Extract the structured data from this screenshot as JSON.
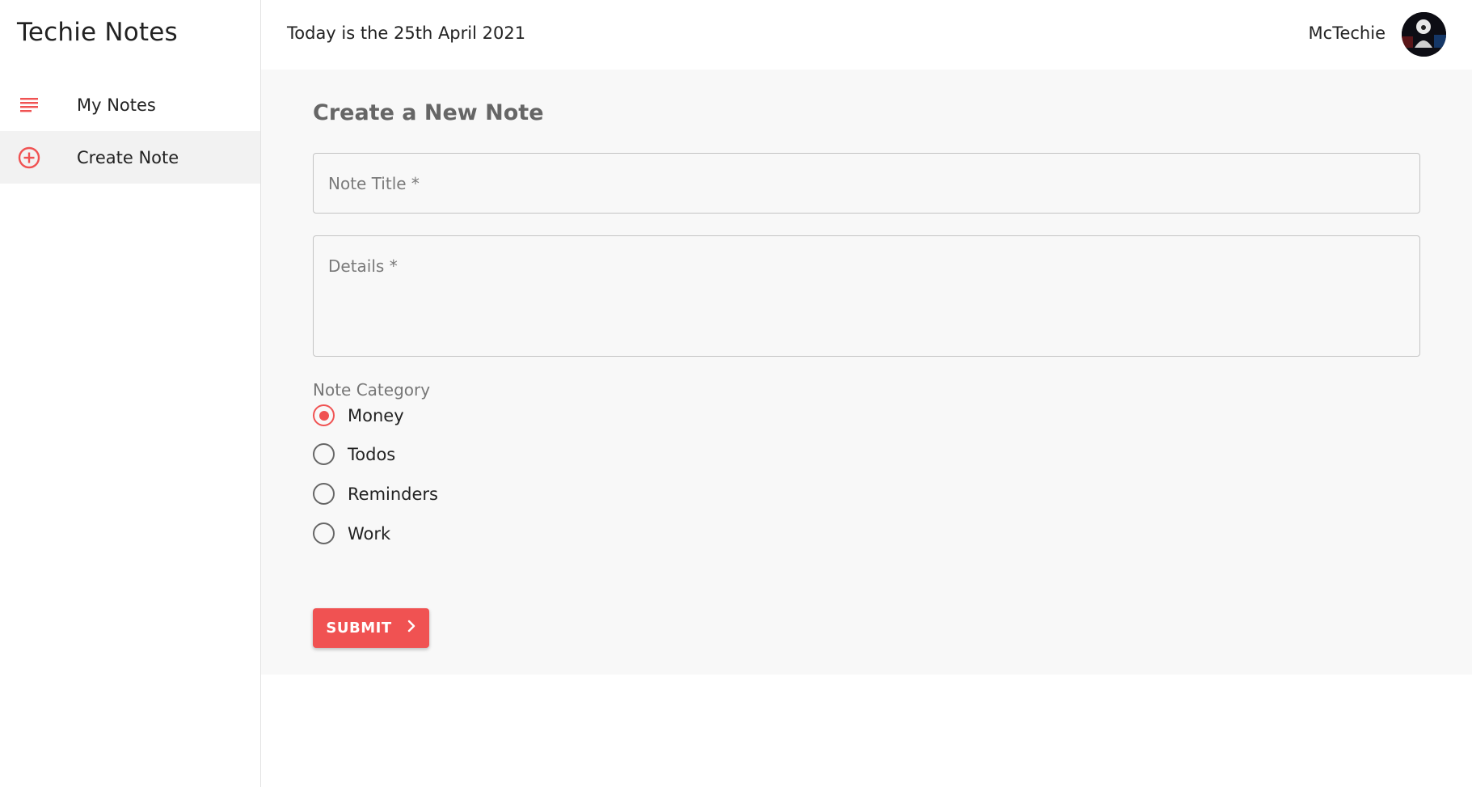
{
  "sidebar": {
    "brand": "Techie Notes",
    "items": [
      {
        "label": "My Notes",
        "icon": "subject-icon"
      },
      {
        "label": "Create Note",
        "icon": "add-circle-icon"
      }
    ]
  },
  "header": {
    "date_text": "Today is the 25th April 2021",
    "user_name": "McTechie"
  },
  "main": {
    "title": "Create a New Note",
    "title_field": {
      "placeholder": "Note Title *"
    },
    "details_field": {
      "placeholder": "Details *"
    },
    "category": {
      "label": "Note Category",
      "options": [
        "Money",
        "Todos",
        "Reminders",
        "Work"
      ],
      "selected": "Money"
    },
    "submit_label": "SUBMIT"
  },
  "colors": {
    "accent": "#f05252",
    "main_bg": "#f8f8f8",
    "active_nav_bg": "#f2f2f2"
  }
}
